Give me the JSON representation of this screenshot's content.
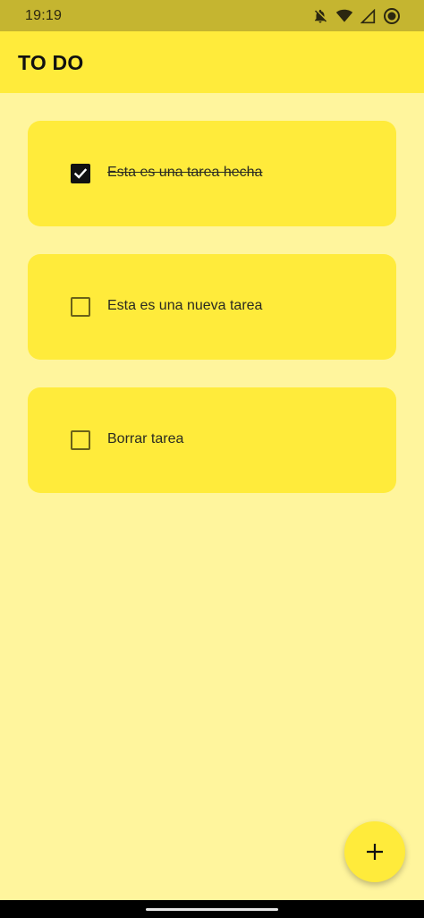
{
  "status_bar": {
    "time": "19:19",
    "icons": [
      "notifications-off-icon",
      "wifi-icon",
      "signal-icon",
      "record-icon"
    ]
  },
  "app_bar": {
    "title": "TO DO"
  },
  "tasks": [
    {
      "label": "Esta es una tarea hecha",
      "checked": true
    },
    {
      "label": "Esta es una nueva tarea",
      "checked": false
    },
    {
      "label": "Borrar tarea",
      "checked": false
    }
  ],
  "fab": {
    "icon": "plus-icon"
  },
  "colors": {
    "status_bar_bg": "#c5b530",
    "app_bar_bg": "#ffeb3b",
    "page_bg": "#fff59d",
    "card_bg": "#ffeb3b",
    "fab_bg": "#ffeb3b"
  }
}
